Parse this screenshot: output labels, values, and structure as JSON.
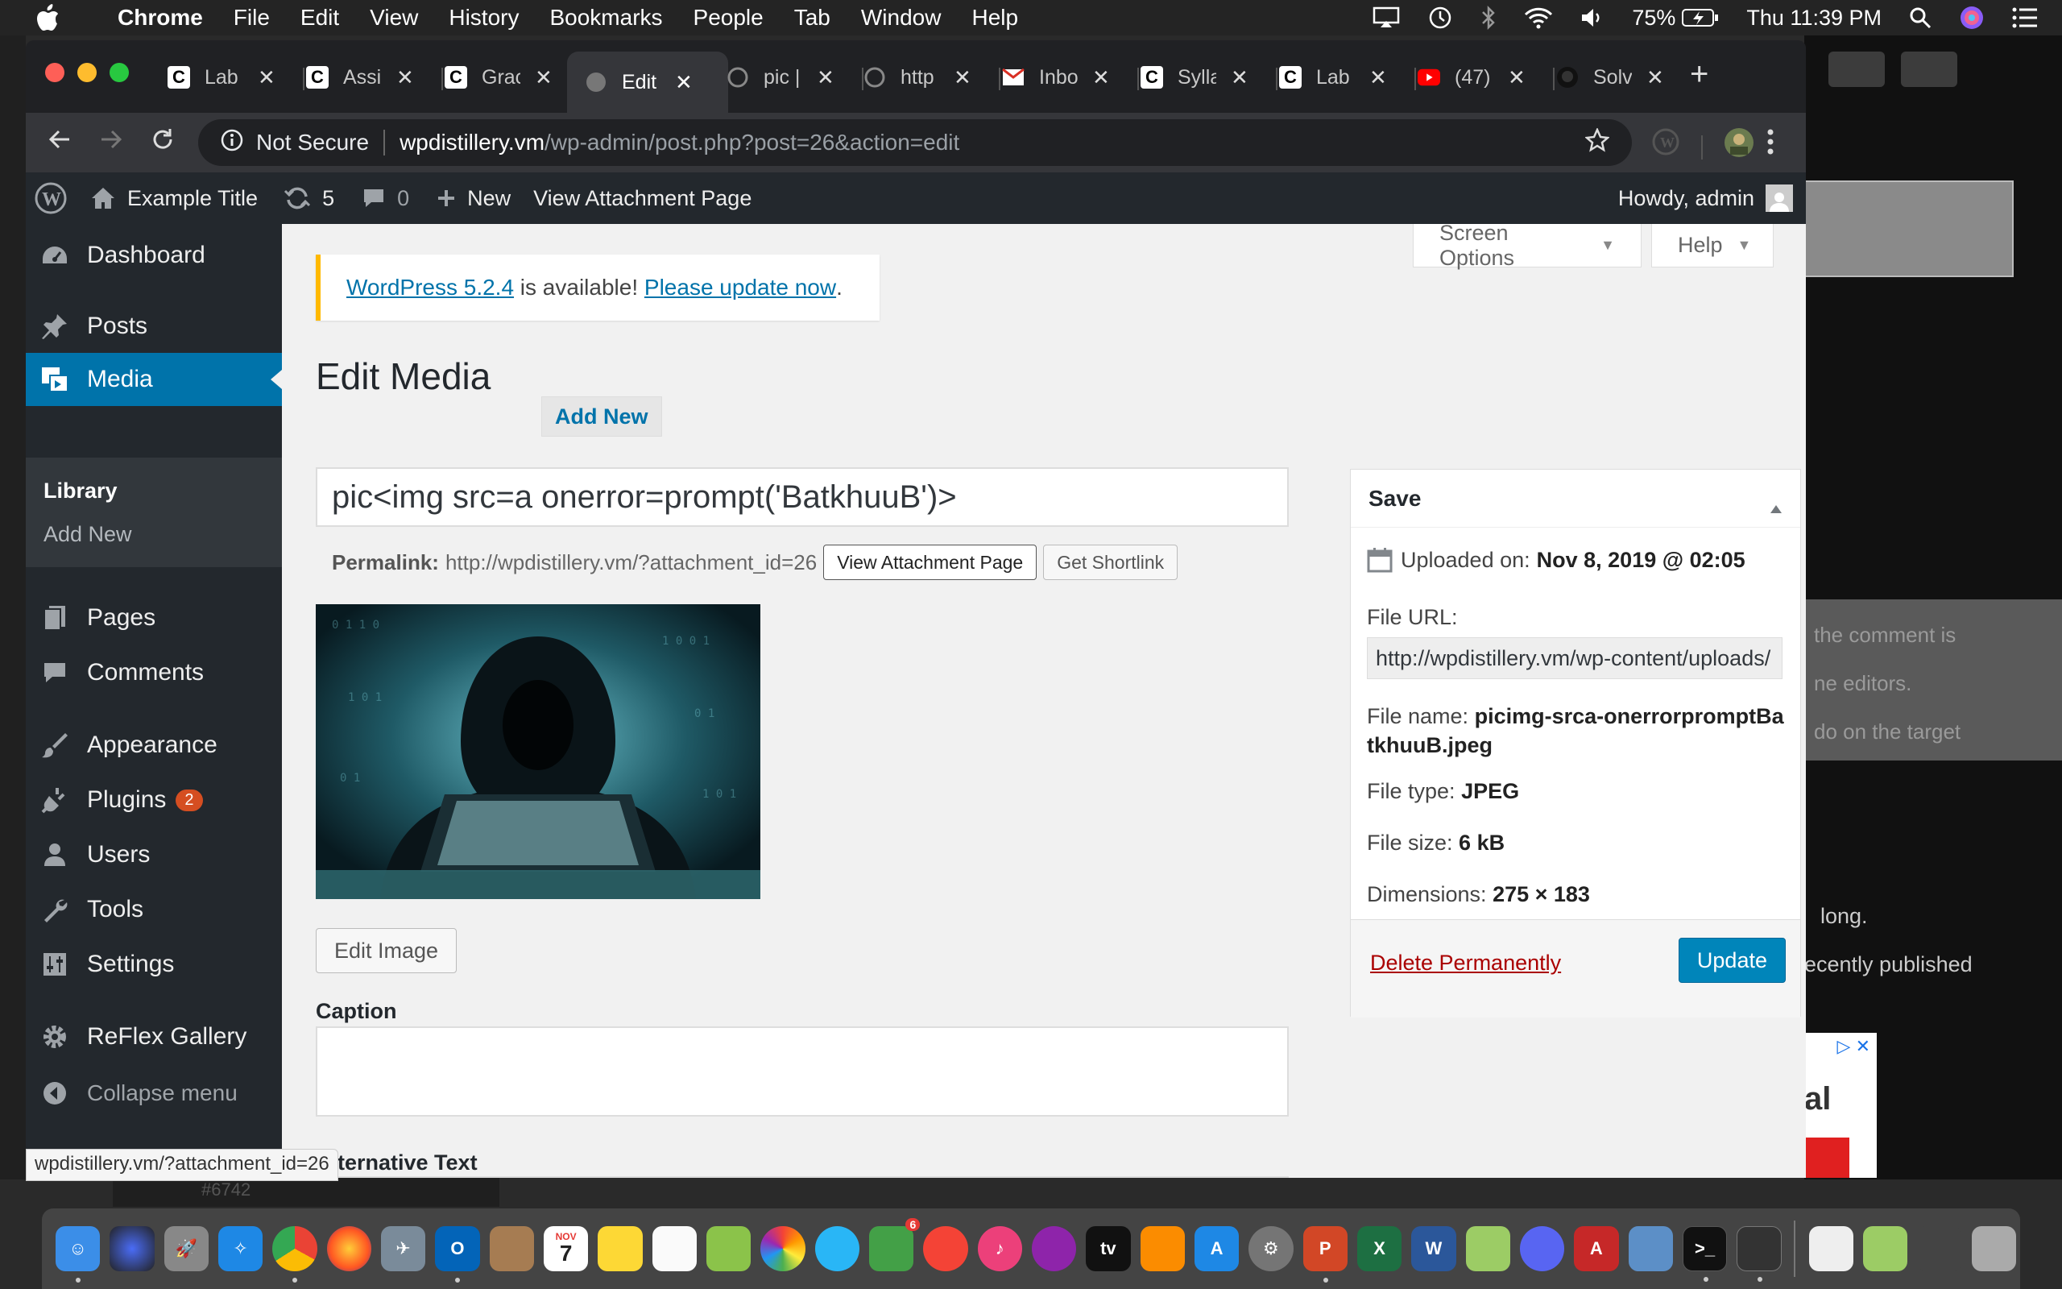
{
  "menubar": {
    "app": "Chrome",
    "items": [
      "File",
      "Edit",
      "View",
      "History",
      "Bookmarks",
      "People",
      "Tab",
      "Window",
      "Help"
    ],
    "battery": "75%",
    "clock": "Thu 11:39 PM"
  },
  "tabs": [
    {
      "label": "Lab",
      "icon": "canvas-icon"
    },
    {
      "label": "Assi",
      "icon": "canvas-icon"
    },
    {
      "label": "Grac",
      "icon": "canvas-icon"
    },
    {
      "label": "Edit",
      "icon": "globe-icon",
      "active": true
    },
    {
      "label": "pic |",
      "icon": "globe-icon"
    },
    {
      "label": "http",
      "icon": "globe-icon"
    },
    {
      "label": "Inbo",
      "icon": "gmail-icon"
    },
    {
      "label": "Sylla",
      "icon": "canvas-icon"
    },
    {
      "label": "Lab",
      "icon": "canvas-icon"
    },
    {
      "label": "(47)",
      "icon": "youtube-icon"
    },
    {
      "label": "Solv",
      "icon": "github-icon"
    }
  ],
  "address": {
    "security": "Not Secure",
    "host": "wpdistillery.vm",
    "path": "/wp-admin/post.php?post=26&action=edit"
  },
  "adminbar": {
    "site_title": "Example Title",
    "updates_count": "5",
    "comments_count": "0",
    "new_label": "New",
    "view_label": "View Attachment Page",
    "howdy": "Howdy, admin"
  },
  "sidebar": {
    "items": [
      {
        "label": "Dashboard",
        "icon": "dashboard-icon"
      },
      {
        "label": "Posts",
        "icon": "pin-icon"
      },
      {
        "label": "Media",
        "icon": "media-icon",
        "current": true
      },
      {
        "label": "Pages",
        "icon": "pages-icon"
      },
      {
        "label": "Comments",
        "icon": "comment-icon"
      },
      {
        "label": "Appearance",
        "icon": "brush-icon"
      },
      {
        "label": "Plugins",
        "icon": "plug-icon",
        "badge": "2"
      },
      {
        "label": "Users",
        "icon": "user-icon"
      },
      {
        "label": "Tools",
        "icon": "wrench-icon"
      },
      {
        "label": "Settings",
        "icon": "settings-icon"
      },
      {
        "label": "ReFlex Gallery",
        "icon": "gear-icon"
      }
    ],
    "submenu": [
      "Library",
      "Add New"
    ],
    "collapse": "Collapse menu"
  },
  "screen_options": "Screen Options",
  "help": "Help",
  "notice": {
    "version_link": "WordPress 5.2.4",
    "middle": " is available! ",
    "update_link": "Please update now",
    "end": "."
  },
  "page": {
    "title": "Edit Media",
    "add_new": "Add New",
    "media_title": "pic<img src=a onerror=prompt('BatkhuuB')>",
    "permalink_label": "Permalink:",
    "permalink_url": "http://wpdistillery.vm/?attachment_id=26",
    "view_attachment_btn": "View Attachment Page",
    "shortlink_btn": "Get Shortlink",
    "edit_image_btn": "Edit Image",
    "caption_label": "Caption",
    "alt_label": "Alternative Text"
  },
  "savebox": {
    "title": "Save",
    "uploaded_label": "Uploaded on:",
    "uploaded_value": "Nov 8, 2019 @ 02:05",
    "file_url_label": "File URL:",
    "file_url": "http://wpdistillery.vm/wp-content/uploads/",
    "file_name_label": "File name:",
    "file_name": "picimg-srca-onerrorpromptBatkhuuB.jpeg",
    "file_type_label": "File type:",
    "file_type": "JPEG",
    "file_size_label": "File size:",
    "file_size": "6 kB",
    "dimensions_label": "Dimensions:",
    "dimensions": "275 × 183",
    "delete_label": "Delete Permanently",
    "update_label": "Update"
  },
  "status_bar": "wpdistillery.vm/?attachment_id=26",
  "background": {
    "text1": "the comment is",
    "text2": "ne editors.",
    "text3": "do on the target",
    "text4": "long.",
    "text5": "ecently published",
    "ad_text": "al",
    "bottom_text": "#6742"
  },
  "dock": {
    "calendar_month": "NOV",
    "calendar_day": "7",
    "facetime_badge": "6"
  },
  "colors": {
    "wp_admin_dark": "#23282d",
    "wp_blue": "#0073aa",
    "update_button": "#0085ba",
    "notice_border": "#ffb900",
    "delete_red": "#aa0000"
  }
}
